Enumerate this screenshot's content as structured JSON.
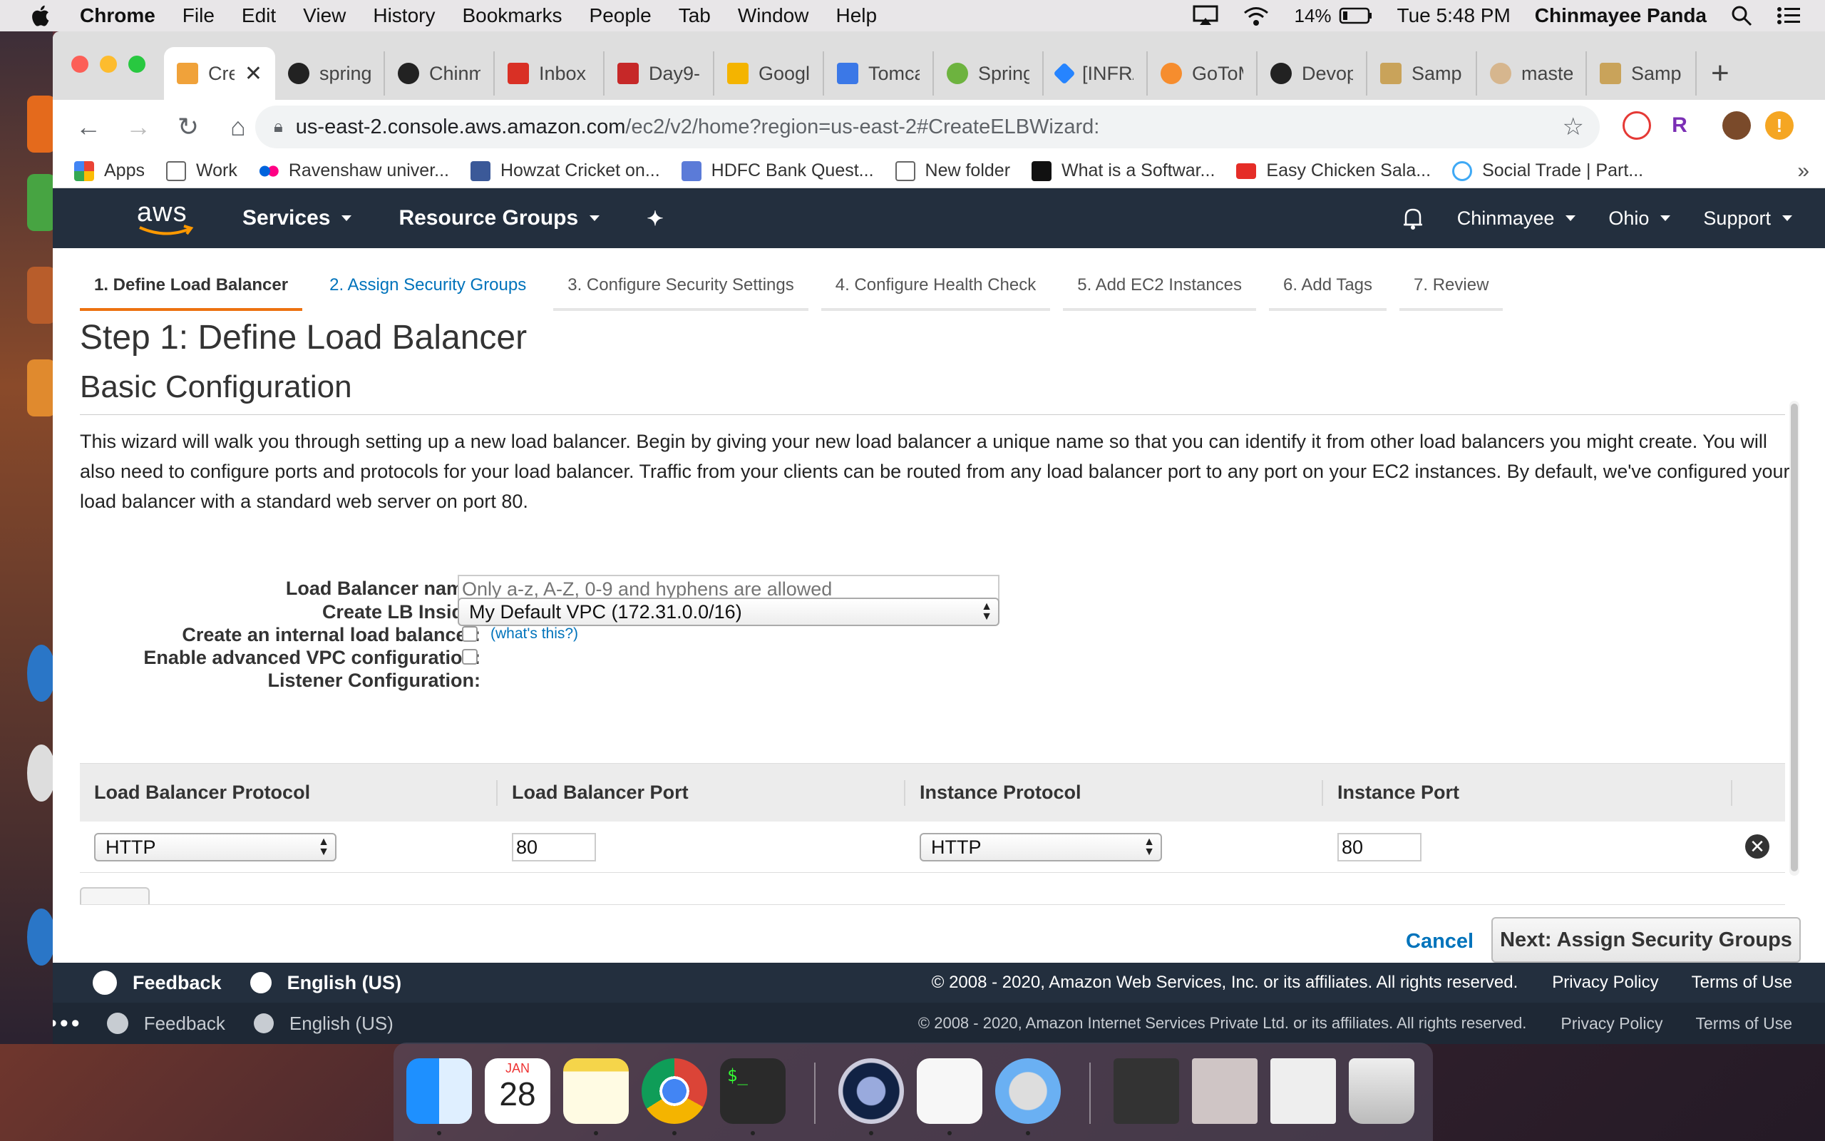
{
  "menubar": {
    "app": "Chrome",
    "items": [
      "File",
      "Edit",
      "View",
      "History",
      "Bookmarks",
      "People",
      "Tab",
      "Window",
      "Help"
    ],
    "battery": "14%",
    "clock": "Tue 5:48 PM",
    "user": "Chinmayee Panda"
  },
  "browser": {
    "tabs": [
      {
        "label": "Cre",
        "icon": "aws-cube-icon",
        "active": true
      },
      {
        "label": "spring",
        "icon": "github-icon"
      },
      {
        "label": "Chinm",
        "icon": "github-icon"
      },
      {
        "label": "Inbox (",
        "icon": "gmail-icon"
      },
      {
        "label": "Day9-",
        "icon": "calendar-icon"
      },
      {
        "label": "Google",
        "icon": "drive-icon"
      },
      {
        "label": "Tomca",
        "icon": "doc-icon"
      },
      {
        "label": "Spring",
        "icon": "spring-icon"
      },
      {
        "label": "[INFRA",
        "icon": "jira-icon"
      },
      {
        "label": "GoToM",
        "icon": "gotomeeting-icon"
      },
      {
        "label": "Devop",
        "icon": "github-icon"
      },
      {
        "label": "Sample",
        "icon": "image-icon"
      },
      {
        "label": "master",
        "icon": "jenkins-icon"
      },
      {
        "label": "Sample",
        "icon": "image-icon"
      }
    ],
    "url_host": "us-east-2.console.aws.amazon.com",
    "url_path": "/ec2/v2/home?region=us-east-2#CreateELBWizard:",
    "bookmarks": [
      {
        "label": "Apps",
        "icon": "apps-grid-icon"
      },
      {
        "label": "Work",
        "icon": "folder-icon"
      },
      {
        "label": "Ravenshaw univer...",
        "icon": "flickr-icon"
      },
      {
        "label": "Howzat Cricket on...",
        "icon": "facebook-icon"
      },
      {
        "label": "HDFC Bank Quest...",
        "icon": "b-icon"
      },
      {
        "label": "New folder",
        "icon": "folder-icon"
      },
      {
        "label": "What is a Softwar...",
        "icon": "site-icon"
      },
      {
        "label": "Easy Chicken Sala...",
        "icon": "youtube-icon"
      },
      {
        "label": "Social Trade | Part...",
        "icon": "s-icon"
      }
    ],
    "more": "»"
  },
  "aws": {
    "logo": "aws",
    "nav": {
      "services": "Services",
      "resource_groups": "Resource Groups"
    },
    "right": {
      "account": "Chinmayee",
      "region": "Ohio",
      "support": "Support"
    }
  },
  "wizard": {
    "steps": [
      "1. Define Load Balancer",
      "2. Assign Security Groups",
      "3. Configure Security Settings",
      "4. Configure Health Check",
      "5. Add EC2 Instances",
      "6. Add Tags",
      "7. Review"
    ],
    "title": "Step 1: Define Load Balancer",
    "section": "Basic Configuration",
    "intro": "This wizard will walk you through setting up a new load balancer. Begin by giving your new load balancer a unique name so that you can identify it from other load balancers you might create. You will also need to configure ports and protocols for your load balancer. Traffic from your clients can be routed from any load balancer port to any port on your EC2 instances. By default, we've configured your load balancer with a standard web server on port 80.",
    "form": {
      "name_label": "Load Balancer name:",
      "name_placeholder": "Only a-z, A-Z, 0-9 and hyphens are allowed",
      "vpc_label": "Create LB Inside:",
      "vpc_value": "My Default VPC (172.31.0.0/16)",
      "internal_label": "Create an internal load balancer:",
      "whats_this": "(what's this?)",
      "advanced_label": "Enable advanced VPC configuration:",
      "listener_label": "Listener Configuration:"
    },
    "listener": {
      "headers": [
        "Load Balancer Protocol",
        "Load Balancer Port",
        "Instance Protocol",
        "Instance Port"
      ],
      "row": {
        "lb_protocol": "HTTP",
        "lb_port": "80",
        "instance_protocol": "HTTP",
        "instance_port": "80"
      }
    },
    "cancel": "Cancel",
    "next": "Next: Assign Security Groups"
  },
  "footer": {
    "feedback": "Feedback",
    "language": "English (US)",
    "copyright": "© 2008 - 2020, Amazon Web Services, Inc. or its affiliates. All rights reserved.",
    "privacy": "Privacy Policy",
    "terms": "Terms of Use",
    "copyright2": "© 2008 - 2020, Amazon Internet Services Private Ltd. or its affiliates. All rights reserved."
  },
  "dock": {
    "calendar_month": "JAN",
    "calendar_day": "28"
  }
}
